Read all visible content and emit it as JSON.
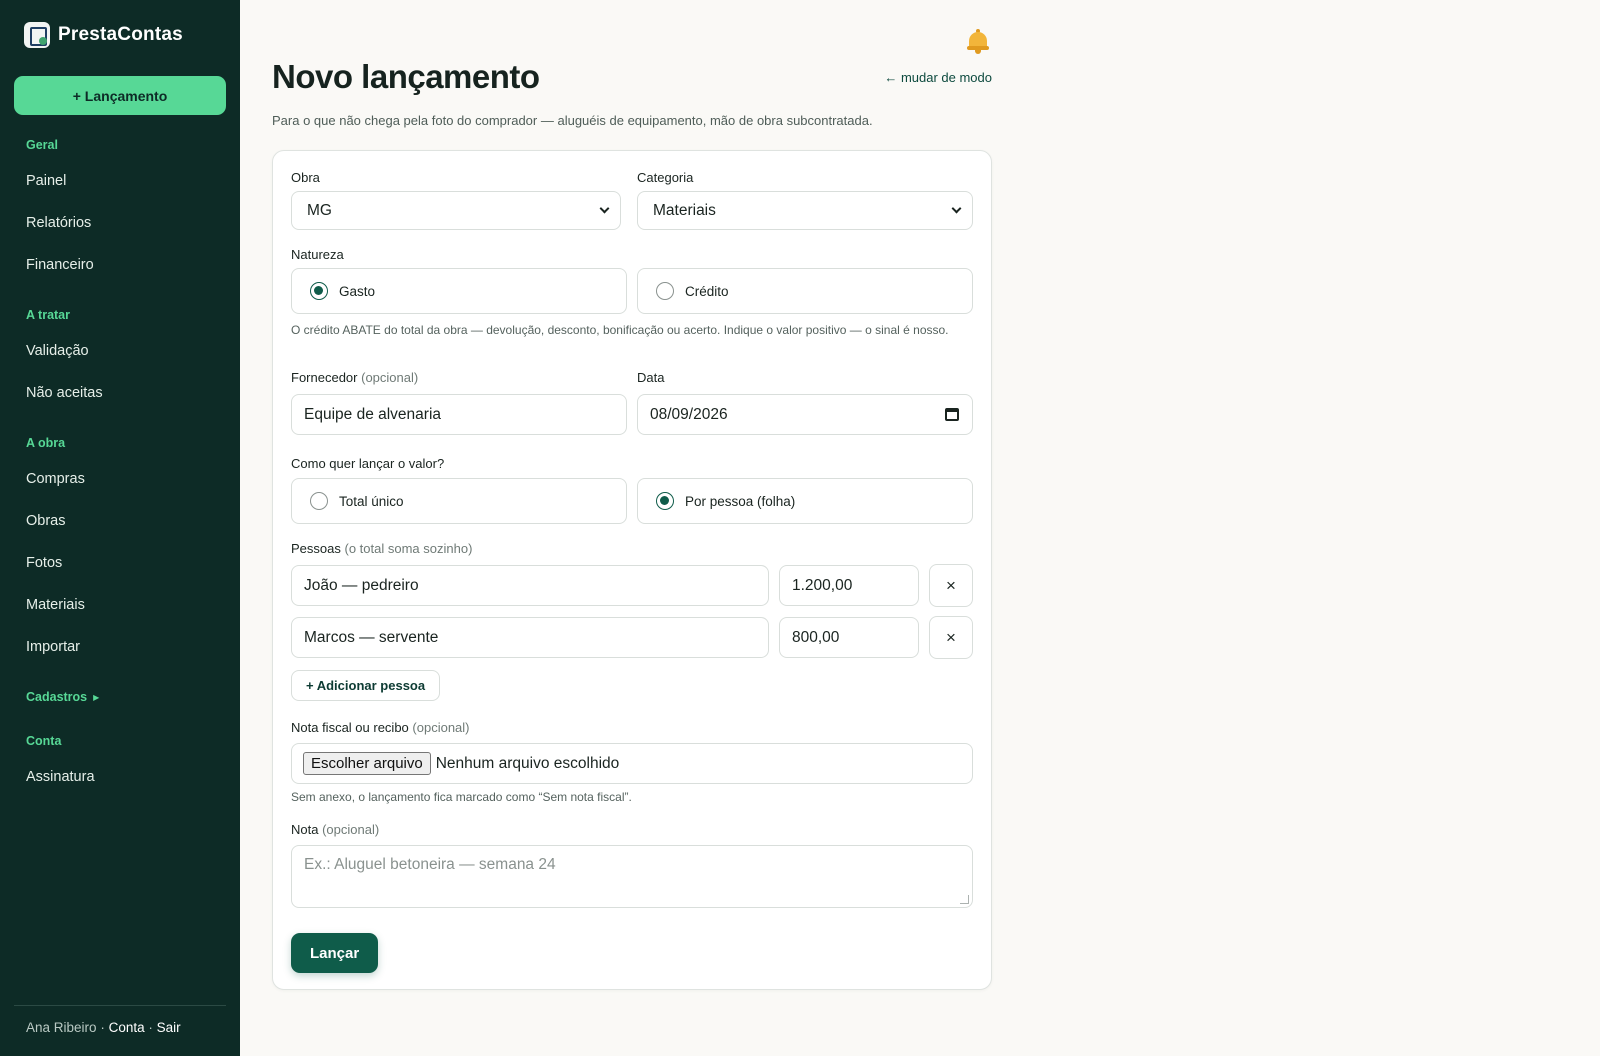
{
  "app": {
    "name": "PrestaContas",
    "new_button": "+ Lançamento"
  },
  "sidebar": {
    "sections": [
      {
        "title": "Geral",
        "items": [
          "Painel",
          "Relatórios",
          "Financeiro"
        ]
      },
      {
        "title": "A tratar",
        "items": [
          "Validação",
          "Não aceitas"
        ]
      },
      {
        "title": "A obra",
        "items": [
          "Compras",
          "Obras",
          "Fotos",
          "Materiais",
          "Importar"
        ]
      },
      {
        "title": "Cadastros",
        "items": []
      },
      {
        "title": "Conta",
        "items": [
          "Assinatura"
        ]
      }
    ],
    "footer": {
      "user": "Ana Ribeiro",
      "sep": "·",
      "account": "Conta",
      "logout": "Sair"
    }
  },
  "header": {
    "title": "Novo lançamento",
    "mode_link": "← mudar de modo",
    "subtitle": "Para o que não chega pela foto do comprador — aluguéis de equipamento, mão de obra subcontratada."
  },
  "form": {
    "obra": {
      "label": "Obra",
      "value": "MG"
    },
    "categoria": {
      "label": "Categoria",
      "value": "Materiais"
    },
    "natureza": {
      "label": "Natureza",
      "options": [
        "Gasto",
        "Crédito"
      ],
      "selected": "Gasto",
      "help": "O crédito ABATE do total da obra — devolução, desconto, bonificação ou acerto. Indique o valor positivo — o sinal é nosso."
    },
    "fornecedor": {
      "label": "Fornecedor",
      "optional": "(opcional)",
      "value": "Equipe de alvenaria"
    },
    "data": {
      "label": "Data",
      "value": "08/09/2026"
    },
    "modo_valor": {
      "label": "Como quer lançar o valor?",
      "options": [
        "Total único",
        "Por pessoa (folha)"
      ],
      "selected": "Por pessoa (folha)"
    },
    "pessoas": {
      "label": "Pessoas",
      "hint": "(o total soma sozinho)",
      "rows": [
        {
          "name": "João — pedreiro",
          "amount": "1.200,00"
        },
        {
          "name": "Marcos — servente",
          "amount": "800,00"
        }
      ],
      "remove_glyph": "×",
      "add_button": "+ Adicionar pessoa"
    },
    "anexo": {
      "label": "Nota fiscal ou recibo",
      "optional": "(opcional)",
      "button": "Escolher arquivo",
      "status": "Nenhum arquivo escolhido",
      "help": "Sem anexo, o lançamento fica marcado como “Sem nota fiscal”."
    },
    "nota": {
      "label": "Nota",
      "optional": "(opcional)",
      "placeholder": "Ex.: Aluguel betoneira — semana 24"
    },
    "submit": "Lançar"
  },
  "icons": {
    "bell": "bell-icon",
    "logo": "prestacontas-logo"
  },
  "colors": {
    "sidebar_bg": "#0d2b26",
    "accent": "#57d896",
    "primary": "#0f5c4a"
  }
}
